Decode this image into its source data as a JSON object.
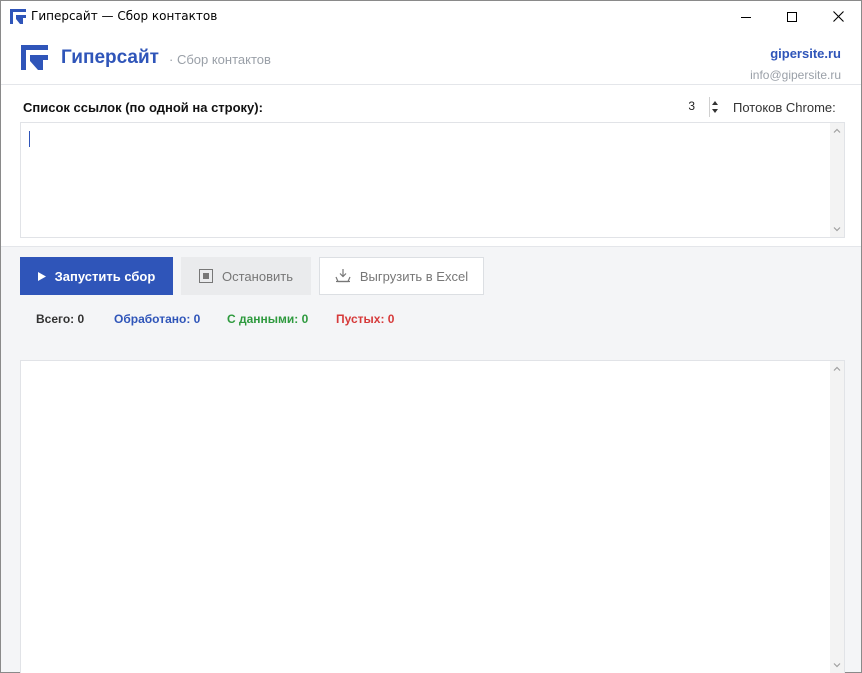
{
  "window": {
    "title": "Гиперсайт — Сбор контактов"
  },
  "header": {
    "brand_name": "Гиперсайт",
    "brand_sub": "· Сбор контактов",
    "site_link": "gipersite.ru",
    "email": "info@gipersite.ru"
  },
  "input": {
    "label": "Список ссылок (по одной на строку):",
    "value": "",
    "threads_value": "3",
    "threads_label": "Потоков Chrome:"
  },
  "actions": {
    "start_label": "Запустить сбор",
    "stop_label": "Остановить",
    "export_label": "Выгрузить в Excel"
  },
  "stats": {
    "total": "Всего: 0",
    "processed": "Обработано: 0",
    "with_data": "С данными: 0",
    "empty": "Пустых: 0"
  },
  "colors": {
    "accent": "#2f55b9",
    "success": "#2e9a3e",
    "danger": "#d63a3a",
    "muted": "#9aa0a8"
  },
  "icons": {
    "app": "gipersite-logo-icon",
    "start": "play-icon",
    "stop": "stop-icon",
    "export": "export-icon"
  }
}
